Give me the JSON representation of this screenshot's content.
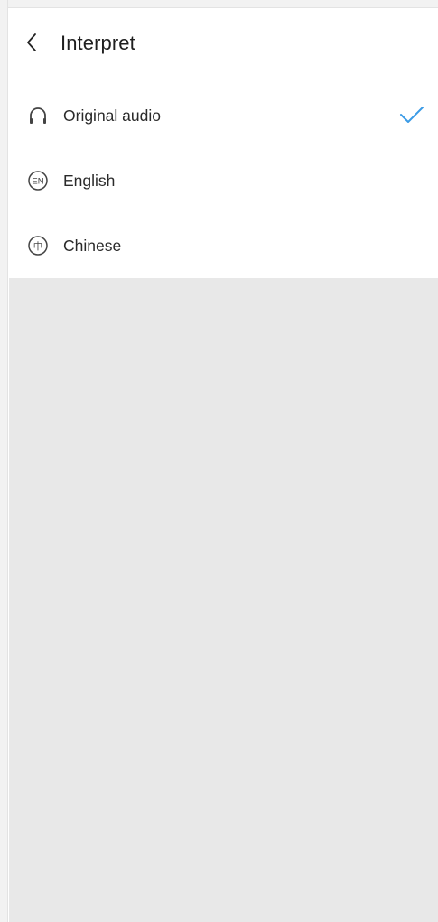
{
  "header": {
    "back_icon": "chevron-left-icon",
    "title": "Interpret"
  },
  "options": [
    {
      "label": "Original audio",
      "icon": "headphones-icon",
      "selected": true
    },
    {
      "label": "English",
      "icon": "en-badge-icon",
      "badge_text": "EN",
      "selected": false
    },
    {
      "label": "Chinese",
      "icon": "zh-badge-icon",
      "badge_text": "中",
      "selected": false
    }
  ],
  "colors": {
    "accent_check": "#3b9be6",
    "text": "#2a2a2a",
    "icon": "#444444",
    "background_gray": "#e8e8e8"
  }
}
